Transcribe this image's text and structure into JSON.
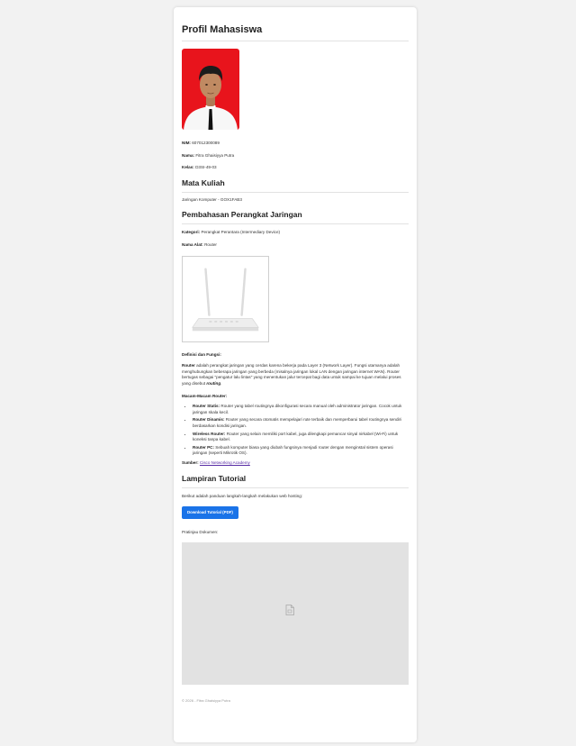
{
  "page": {
    "title": "Profil Mahasiswa"
  },
  "profile": {
    "photo_icon": "student-photo",
    "nim_label": "NIM:",
    "nim": "607012300089",
    "nama_label": "Nama:",
    "nama": "Fitra Ghaisiyya Putra",
    "kelas_label": "Kelas:",
    "kelas": "D3SI-49-03"
  },
  "mata_kuliah": {
    "heading": "Mata Kuliah",
    "course": "Jaringan Komputer - GOX1FAB3"
  },
  "pembahasan": {
    "heading": "Pembahasan Perangkat Jaringan",
    "kategori_label": "Kategori:",
    "kategori": "Perangkat Perantara (Intermediary Device)",
    "nama_alat_label": "Nama Alat:",
    "nama_alat": "Router",
    "router_image": "router-image",
    "definisi_heading": "Definisi dan Fungsi:",
    "definisi_bold": "Router",
    "definisi_text": "adalah perangkat jaringan yang cerdas karena bekerja pada Layer 3 (Network Layer). Fungsi utamanya adalah menghubungkan beberapa jaringan yang berbeda (misalnya jaringan lokal LAN dengan jaringan internet WAN). Router bertugas sebagai \"pengatur lalu lintas\" yang menentukan jalur tercepat bagi data untuk sampai ke tujuan melalui proses yang disebut",
    "definisi_routing": "routing",
    "macam_heading": "Macam-Macam Router:",
    "macam_items": [
      {
        "name": "Router Statis:",
        "desc": "Router yang tabel routingnya dikonfigurasi secara manual oleh administrator jaringan. Cocok untuk jaringan skala kecil."
      },
      {
        "name": "Router Dinamis:",
        "desc": "Router yang secara otomatis mempelajari rute terbaik dan memperbarui tabel routingnya sendiri berdasarkan kondisi jaringan."
      },
      {
        "name": "Wireless Router:",
        "desc": "Router yang selain memiliki port kabel, juga dilengkapi pemancar sinyal nirkabel (Wi-Fi) untuk koneksi tanpa kabel."
      },
      {
        "name": "Router PC:",
        "desc": "Sebuah komputer biasa yang diubah fungsinya menjadi router dengan menginstal sistem operasi jaringan (seperti Mikrotik OS)."
      }
    ],
    "sumber_label": "Sumber:",
    "sumber_link": "Cisco Networking Academy"
  },
  "lampiran": {
    "heading": "Lampiran Tutorial",
    "intro": "Berikut adalah panduan langkah-langkah melakukan web hosting:",
    "download_button": "Download Tutorial (PDF)",
    "preview_label": "Pratinjau Dokumen:",
    "preview_icon": "document-icon"
  },
  "footer": {
    "text": "© 2026 - Fitra Ghaisiyya Putra"
  },
  "colors": {
    "accent": "#1a73e8",
    "link": "#5a2ea6",
    "photo_bg": "#e8141c"
  }
}
